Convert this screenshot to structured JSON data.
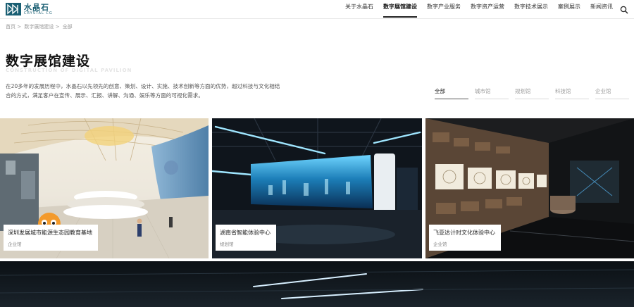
{
  "header": {
    "logo": {
      "name": "水晶石",
      "sub": "CRYSTAL CG"
    },
    "nav": [
      {
        "label": "关于水晶石",
        "active": false
      },
      {
        "label": "数字展馆建设",
        "active": true
      },
      {
        "label": "数字产业服务",
        "active": false
      },
      {
        "label": "数字资产运营",
        "active": false
      },
      {
        "label": "数字技术展示",
        "active": false
      },
      {
        "label": "案例展示",
        "active": false
      },
      {
        "label": "新闻资讯",
        "active": false
      }
    ],
    "search_icon": "search-icon"
  },
  "breadcrumb": {
    "home": "首页",
    "sep": ">",
    "current": "数字展馆建设",
    "sep2": ">",
    "last": "全部"
  },
  "page": {
    "title": "数字展馆建设",
    "subtitle": "CONSTRUCTION OF DIGITAL PAVILION",
    "intro": "在20多年的发展历程中，水晶石以先领先的创意、策划、设计、实施、技术创新等方面的优势，超过科技与文化相结合的方式，满足客户在宣传、展示、汇报、讲解、沟通、娱乐等方面的可视化需求。"
  },
  "filters": [
    {
      "label": "全部",
      "active": true
    },
    {
      "label": "城市馆",
      "active": false
    },
    {
      "label": "规划馆",
      "active": false
    },
    {
      "label": "科技馆",
      "active": false
    },
    {
      "label": "企业馆",
      "active": false
    }
  ],
  "cards": [
    {
      "title": "深圳发展城市能源生态园教育基地",
      "tag": "企业馆"
    },
    {
      "title": "湖南省智能体验中心",
      "tag": "规划馆"
    },
    {
      "title": "飞亚达计时文化体验中心",
      "tag": "企业馆"
    }
  ],
  "colors": {
    "brand": "#1a5f73",
    "active_nav": "#222222"
  }
}
